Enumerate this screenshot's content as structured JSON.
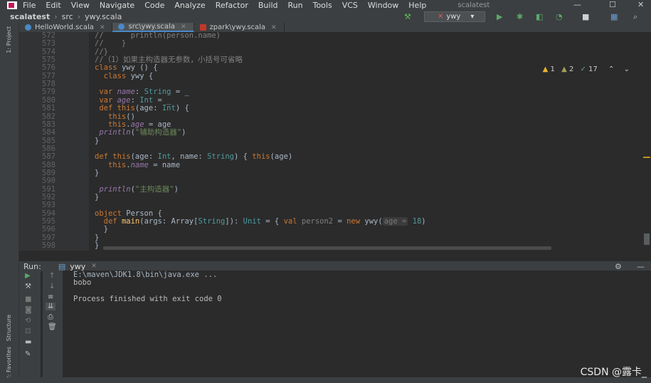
{
  "menubar": {
    "items": [
      "File",
      "Edit",
      "View",
      "Navigate",
      "Code",
      "Analyze",
      "Refactor",
      "Build",
      "Run",
      "Tools",
      "VCS",
      "Window",
      "Help"
    ],
    "window_title": "scalatest"
  },
  "navbar": {
    "project": "scalatest",
    "folder": "src",
    "file": "ywy.scala",
    "run_config": "ywy"
  },
  "sidebar": {
    "project_label": "1: Project",
    "structure_label": "Structure",
    "favorites_label": "2: Favorites"
  },
  "tabs": [
    {
      "label": "HelloWorld.scala",
      "color": "#4a88c7"
    },
    {
      "label": "src\\ywy.scala",
      "color": "#4a88c7"
    },
    {
      "label": "zpark\\ywy.scala",
      "color": "#c0392b"
    }
  ],
  "inspections": {
    "warnings": "1",
    "weak": "2",
    "typos": "17"
  },
  "line_numbers": [
    "572",
    "573",
    "574",
    "575",
    "576",
    "577",
    "578",
    "579",
    "580",
    "581",
    "582",
    "583",
    "584",
    "585",
    "586",
    "587",
    "588",
    "589",
    "590",
    "591",
    "592",
    "593",
    "594",
    "595",
    "596",
    "597",
    "598"
  ],
  "run_panel": {
    "label": "Run:",
    "tab": "ywy",
    "output": [
      "E:\\maven\\JDK1.8\\bin\\java.exe ...",
      "bobo",
      "",
      "Process finished with exit code 0"
    ]
  },
  "watermark": "CSDN @露卡_"
}
